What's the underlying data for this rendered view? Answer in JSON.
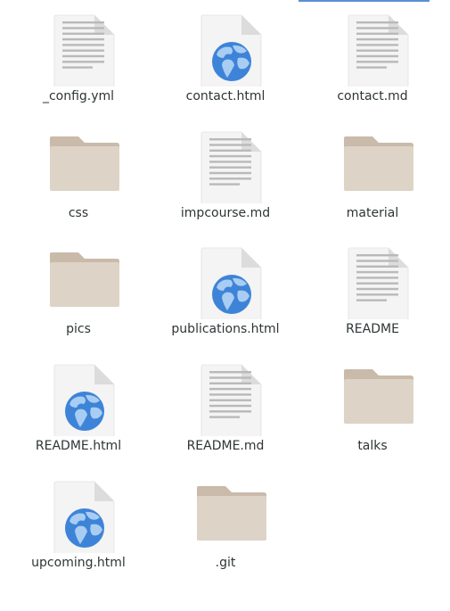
{
  "file_view": {
    "items": [
      {
        "name": "_config.yml",
        "type": "text",
        "icon": "text-file-icon"
      },
      {
        "name": "contact.html",
        "type": "html",
        "icon": "html-file-icon"
      },
      {
        "name": "contact.md",
        "type": "text",
        "icon": "text-file-icon"
      },
      {
        "name": "css",
        "type": "folder",
        "icon": "folder-icon"
      },
      {
        "name": "impcourse.md",
        "type": "text",
        "icon": "text-file-icon"
      },
      {
        "name": "material",
        "type": "folder",
        "icon": "folder-icon"
      },
      {
        "name": "pics",
        "type": "folder",
        "icon": "folder-icon"
      },
      {
        "name": "publications.html",
        "type": "html",
        "icon": "html-file-icon"
      },
      {
        "name": "README",
        "type": "text",
        "icon": "text-file-icon"
      },
      {
        "name": "README.html",
        "type": "html",
        "icon": "html-file-icon"
      },
      {
        "name": "README.md",
        "type": "text",
        "icon": "text-file-icon"
      },
      {
        "name": "talks",
        "type": "folder",
        "icon": "folder-icon"
      },
      {
        "name": "upcoming.html",
        "type": "html",
        "icon": "html-file-icon"
      },
      {
        "name": ".git",
        "type": "folder",
        "icon": "folder-icon"
      }
    ]
  },
  "colors": {
    "folder_back": "#c9baa9",
    "folder_front": "#ddd3c6",
    "page": "#f4f4f4",
    "page_fold": "#dcdcdc",
    "text_lines": "#b9b9b9",
    "globe_water": "#3d84d8",
    "globe_land": "#a9cdf2",
    "label_text": "#2e3436",
    "scroll_indicator": "#5b8ed6"
  }
}
